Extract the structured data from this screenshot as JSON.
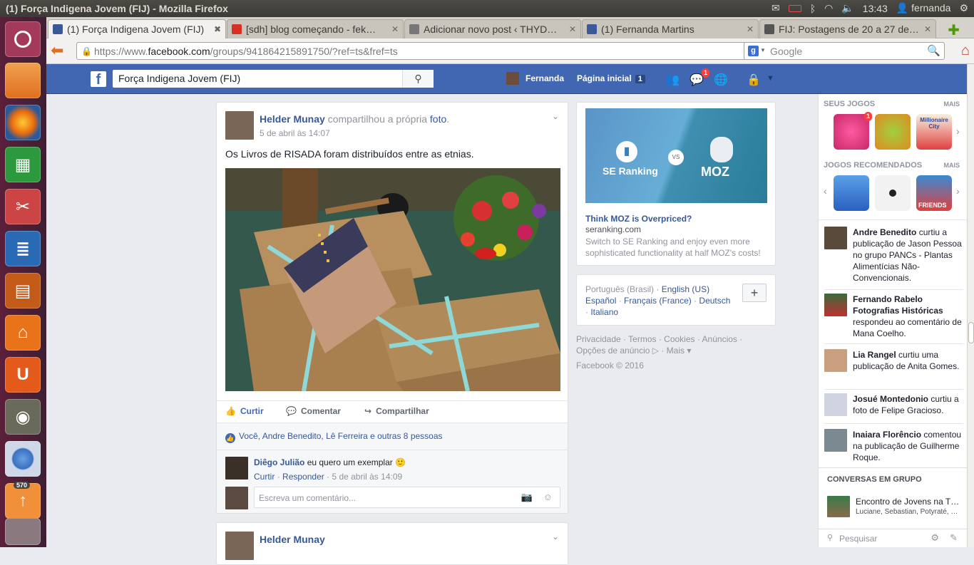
{
  "window": {
    "title": "(1) Força Indigena Jovem (FIJ) - Mozilla Firefox",
    "clock": "13:43",
    "user": "fernanda"
  },
  "launcher": {
    "items": [
      "ubuntu-home",
      "files",
      "firefox",
      "calc",
      "settings",
      "writer",
      "impress",
      "software-center",
      "ubuntu-one",
      "gimp",
      "chromium",
      "update-manager"
    ],
    "update_badge": "570"
  },
  "tabs": [
    {
      "label": "(1) Força Indigena Jovem (FIJ)",
      "icon": "facebook-icon",
      "active": true
    },
    {
      "label": "[sdh] blog começando - fek…",
      "icon": "gmail-icon",
      "active": false
    },
    {
      "label": "Adicionar novo post ‹ THYD…",
      "icon": "blank-icon",
      "active": false
    },
    {
      "label": "(1) Fernanda Martins",
      "icon": "facebook-icon",
      "active": false
    },
    {
      "label": "FIJ: Postagens de 20 a 27 de…",
      "icon": "page-icon",
      "active": false
    }
  ],
  "nav": {
    "url_prefix": "https://www.",
    "url_domain": "facebook.com",
    "url_rest": "/groups/941864215891750/?ref=ts&fref=ts",
    "search_placeholder": "Google"
  },
  "fb": {
    "search_value": "Força Indigena Jovem (FIJ)",
    "user_name": "Fernanda",
    "home_label": "Página inicial",
    "home_count": "1",
    "messages_badge": "1"
  },
  "post": {
    "author": "Helder Munay",
    "action": "compartilhou a própria",
    "action_link": "foto",
    "action_end": ".",
    "date": "5 de abril às 14:07",
    "text": "Os Livros de RISADA foram distribuídos entre as etnias.",
    "like_label": "Curtir",
    "comment_label": "Comentar",
    "share_label": "Compartilhar",
    "likes_summary": "Você, Andre Benedito, Lê Ferreira e outras 8 pessoas",
    "comment": {
      "author": "Diêgo Julião",
      "text": "eu quero um exemplar 🙂",
      "like": "Curtir",
      "reply": "Responder",
      "date": "5 de abril às 14:09"
    },
    "comment_placeholder": "Escreva um comentário..."
  },
  "post2": {
    "author": "Helder Munay"
  },
  "ad": {
    "title": "Think MOZ is Overpriced?",
    "domain": "seranking.com",
    "body": "Switch to SE Ranking and enjoy even more sophisticated functionality at half MOZ's costs!",
    "logo_left": "SE Ranking",
    "vs": "VS",
    "logo_right": "MOZ"
  },
  "languages": {
    "current": "Português (Brasil)",
    "sep": "·",
    "items": [
      "English (US)",
      "Español",
      "Français (France)",
      "Deutsch",
      "Italiano"
    ],
    "plus": "+"
  },
  "footer": {
    "links": [
      "Privacidade",
      "Termos",
      "Cookies",
      "Anúncios",
      "Opções de anúncio",
      "Mais"
    ],
    "copyright": "Facebook © 2016"
  },
  "sidebar": {
    "my_games": "SEUS JOGOS",
    "more": "MAIS",
    "recommended": "JOGOS RECOMENDADOS",
    "candy_badge": "1",
    "game_label": "FRIENDS",
    "game_city": "Millionaire City",
    "ticker": [
      {
        "name": "Andre Benedito",
        "rest": "curtiu a publicação de Jason Pessoa no grupo PANCs - Plantas Alimentícias Não-Convencionais."
      },
      {
        "name": "Fernando Rabelo Fotografias Históricas",
        "rest": "respondeu ao comentário de Mana Coelho."
      },
      {
        "name": "Lia Rangel",
        "rest": "curtiu uma publicação de Anita Gomes."
      },
      {
        "name": "Josué Montedonio",
        "rest": "curtiu a foto de Felipe Gracioso."
      },
      {
        "name": "Inaiara Florêncio",
        "rest": "comentou na publicação de Guilherme Roque."
      }
    ],
    "group_chats": "CONVERSAS EM GRUPO",
    "chat_title": "Encontro de Jovens na T…",
    "chat_members": "Luciane, Sebastian, Potyraté, …",
    "chat_search": "Pesquisar"
  }
}
